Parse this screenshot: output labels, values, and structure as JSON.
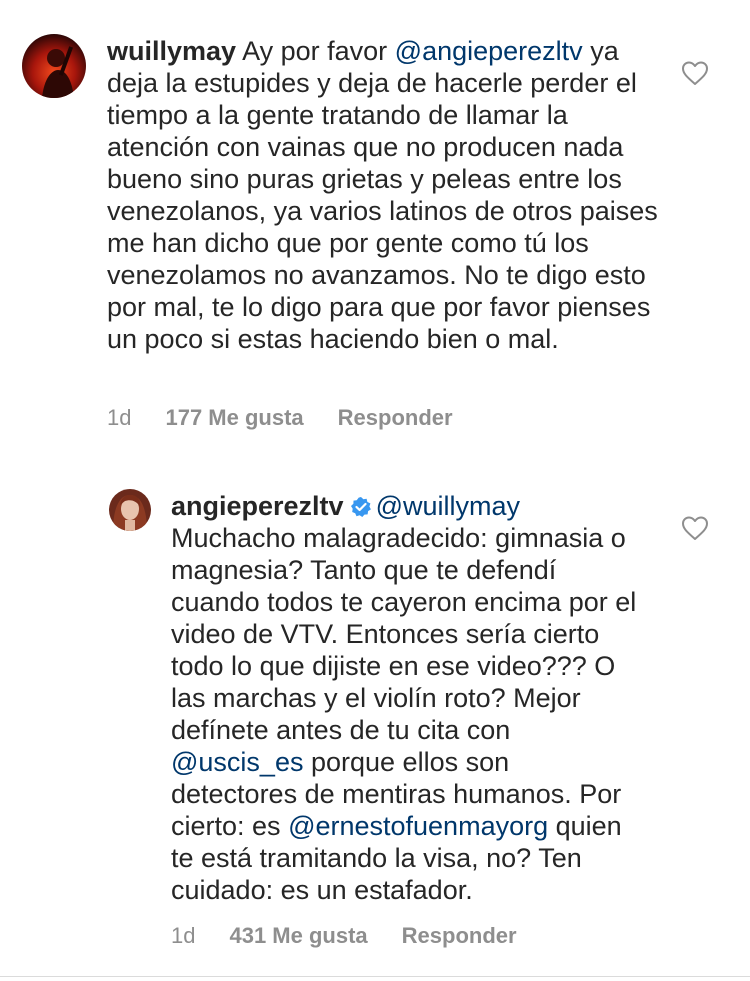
{
  "comments": [
    {
      "username": "wuillymay",
      "mention": "@angieperezltv",
      "text_after_mention": "ya deja la estupides y deja de hacerle perder el tiempo a la gente tratando de llamar la atención con vainas que no producen nada bueno sino puras grietas y peleas entre los venezolanos, ya varios latinos de otros paises me han dicho que por gente como tú los venezolamos no avanzamos. No te digo esto por mal, te lo digo para que por favor pienses un poco si estas haciendo bien o mal.",
      "text_before_mention": "Ay por favor",
      "time": "1d",
      "likes": "177 Me gusta",
      "reply": "Responder"
    },
    {
      "username": "angieperezltv",
      "verified": true,
      "mention": "@wuillymay",
      "text": "Muchacho malagradecido: gimnasia o magnesia? Tanto que te defendí cuando todos te cayeron encima por el video de VTV. Entonces sería cierto todo lo que dijiste en ese video??? O las marchas y el violín roto? Mejor defínete antes de tu cita con",
      "mention2": "@uscis_es",
      "text2": "porque ellos son detectores de mentiras humanos. Por cierto: es",
      "mention3": "@ernestofuenmayorg",
      "text3": "quien te está tramitando la visa, no? Ten cuidado: es un estafador.",
      "time": "1d",
      "likes": "431 Me gusta",
      "reply": "Responder"
    }
  ],
  "colors": {
    "text": "#262626",
    "mention": "#00376b",
    "meta": "#8e8e8e",
    "verified": "#3897f0"
  },
  "icons": [
    "heart-icon",
    "verified-badge-icon"
  ]
}
